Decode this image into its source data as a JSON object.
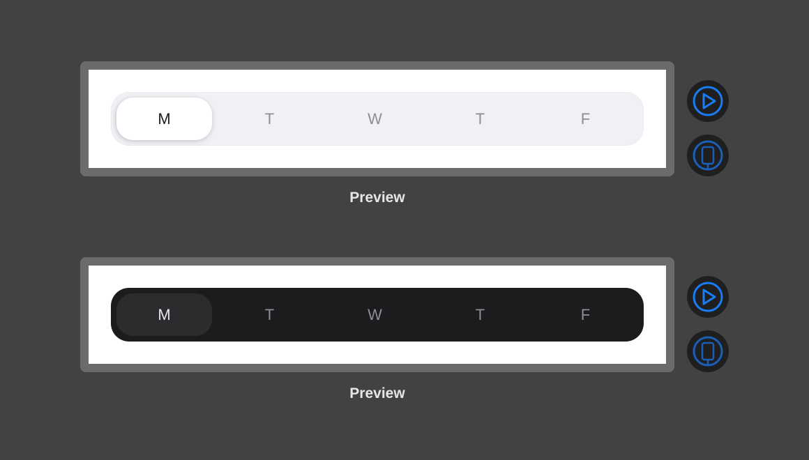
{
  "colors": {
    "background": "#424242",
    "frame": "#6b6b6b",
    "accent": "#1a7cf5",
    "light_track": "#f1f0f5",
    "dark_track": "#1c1c1e",
    "dark_selected": "#2c2c2e"
  },
  "previews": [
    {
      "theme": "light",
      "segments": [
        "M",
        "T",
        "W",
        "T",
        "F"
      ],
      "selected_index": 0,
      "caption": "Preview",
      "buttons": {
        "play_icon": "play-circle-icon",
        "device_icon": "device-icon"
      }
    },
    {
      "theme": "dark",
      "segments": [
        "M",
        "T",
        "W",
        "T",
        "F"
      ],
      "selected_index": 0,
      "caption": "Preview",
      "buttons": {
        "play_icon": "play-circle-icon",
        "device_icon": "device-icon"
      }
    }
  ]
}
